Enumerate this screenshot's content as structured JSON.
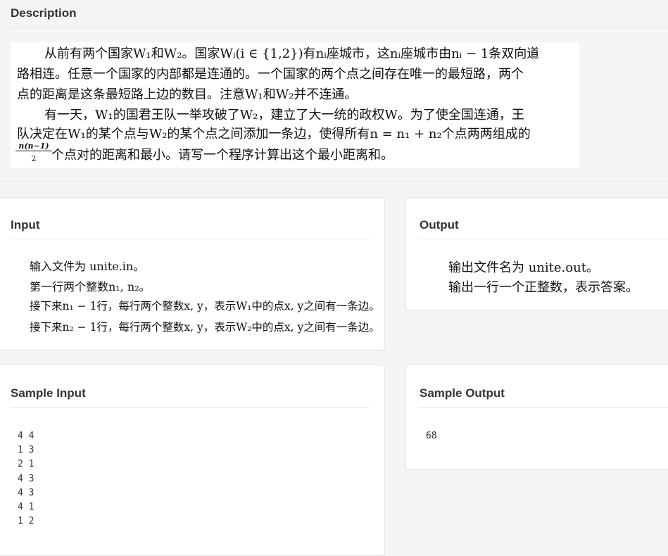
{
  "description": {
    "heading": "Description",
    "lines": [
      "从前有两个国家W₁和W₂。国家Wᵢ(i ∈ {1,2})有nᵢ座城市，这nᵢ座城市由nᵢ − 1条双向道",
      "路相连。任意一个国家的内部都是连通的。一个国家的两个点之间存在唯一的最短路，两个",
      "点的距离是这条最短路上边的数目。注意W₁和W₂并不连通。",
      "有一天，W₁的国君王队一举攻破了W₂，建立了大一统的政权W。为了使全国连通，王",
      "队决定在W₁的某个点与W₂的某个点之间添加一条边，使得所有n = n₁ + n₂个点两两组成的",
      "个点对的距离和最小。请写一个程序计算出这个最小距离和。"
    ],
    "fraction_numerator": "n(n−1)",
    "fraction_denominator": "2"
  },
  "input": {
    "heading": "Input",
    "lines": [
      "输入文件为 unite.in。",
      "第一行两个整数n₁, n₂。",
      "接下来n₁ − 1行，每行两个整数x, y，表示W₁中的点x, y之间有一条边。",
      "接下来n₂ − 1行，每行两个整数x, y，表示W₂中的点x, y之间有一条边。"
    ]
  },
  "output": {
    "heading": "Output",
    "lines": [
      "输出文件名为 unite.out。",
      "输出一行一个正整数，表示答案。"
    ]
  },
  "sample_input": {
    "heading": "Sample Input",
    "text": "4 4\n1 3\n2 1\n4 3\n4 3\n4 1\n1 2"
  },
  "sample_output": {
    "heading": "Sample Output",
    "text": "68"
  }
}
